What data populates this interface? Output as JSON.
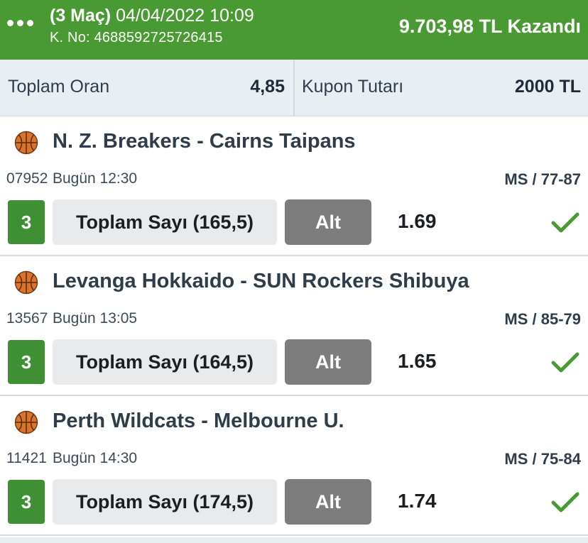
{
  "header": {
    "menu_icon": "more-dots-icon",
    "match_count": "(3 Maç)",
    "datetime": "04/04/2022 10:09",
    "coupon_no": "K. No: 4688592725726415",
    "winnings": "9.703,98 TL Kazandı",
    "bg_color": "#4a9a33"
  },
  "summary": {
    "total_odds_label": "Toplam Oran",
    "total_odds_value": "4,85",
    "stake_label": "Kupon Tutarı",
    "stake_value": "2000 TL"
  },
  "events": [
    {
      "icon": "basketball-icon",
      "title": "N. Z. Breakers - Cairns Taipans",
      "code": "07952",
      "time": "Bugün 12:30",
      "result": "MS / 77-87",
      "mbs": "3",
      "market": "Toplam Sayı (165,5)",
      "pick": "Alt",
      "odd": "1.69",
      "status_icon": "check-icon"
    },
    {
      "icon": "basketball-icon",
      "title": "Levanga Hokkaido - SUN Rockers Shibuya",
      "code": "13567",
      "time": "Bugün 13:05",
      "result": "MS / 85-79",
      "mbs": "3",
      "market": "Toplam Sayı (164,5)",
      "pick": "Alt",
      "odd": "1.65",
      "status_icon": "check-icon"
    },
    {
      "icon": "basketball-icon",
      "title": "Perth Wildcats - Melbourne U.",
      "code": "11421",
      "time": "Bugün 14:30",
      "result": "MS / 75-84",
      "mbs": "3",
      "market": "Toplam Sayı (174,5)",
      "pick": "Alt",
      "odd": "1.74",
      "status_icon": "check-icon"
    }
  ]
}
